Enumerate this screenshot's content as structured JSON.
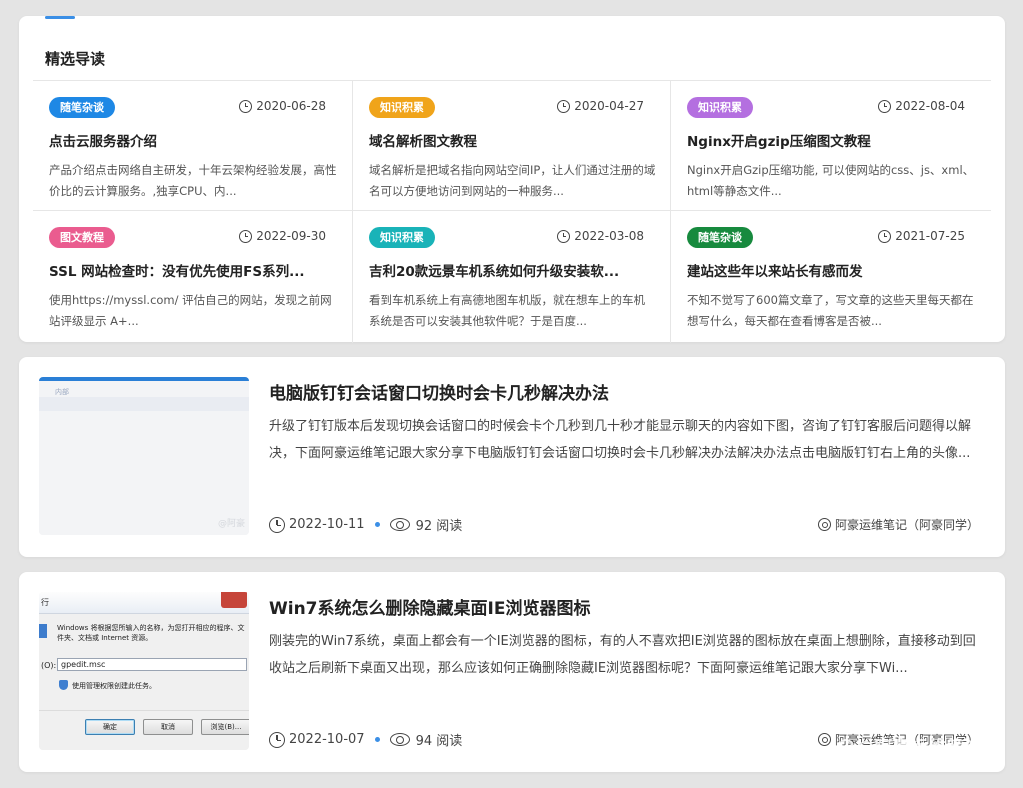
{
  "featured": {
    "title": "精选导读",
    "items": [
      {
        "tag": "随笔杂谈",
        "tag_color": "#1e88e5",
        "date": "2020-06-28",
        "title": "点击云服务器介绍",
        "excerpt": "产品介绍点击网络自主研发，十年云架构经验发展，高性价比的云计算服务。,独享CPU、内..."
      },
      {
        "tag": "知识积累",
        "tag_color": "#f0a41a",
        "date": "2020-04-27",
        "title": "域名解析图文教程",
        "excerpt": "域名解析是把域名指向网站空间IP，让人们通过注册的域名可以方便地访问到网站的一种服务..."
      },
      {
        "tag": "知识积累",
        "tag_color": "#b46fe0",
        "date": "2022-08-04",
        "title": "Nginx开启gzip压缩图文教程",
        "excerpt": "Nginx开启Gzip压缩功能, 可以使网站的css、js、xml、html等静态文件..."
      },
      {
        "tag": "图文教程",
        "tag_color": "#ea5c8f",
        "date": "2022-09-30",
        "title": "SSL 网站检查时：没有优先使用FS系列...",
        "excerpt": "使用https://myssl.com/ 评估自己的网站，发现之前网站评级显示 A+..."
      },
      {
        "tag": "知识积累",
        "tag_color": "#19b3b8",
        "date": "2022-03-08",
        "title": "吉利20款远景车机系统如何升级安装软...",
        "excerpt": "看到车机系统上有高德地图车机版，就在想车上的车机系统是否可以安装其他软件呢？于是百度..."
      },
      {
        "tag": "随笔杂谈",
        "tag_color": "#178a3e",
        "date": "2021-07-25",
        "title": "建站这些年以来站长有感而发",
        "excerpt": "不知不觉写了600篇文章了，写文章的这些天里每天都在想写什么，每天都在查看博客是否被..."
      }
    ]
  },
  "posts": [
    {
      "title": "电脑版钉钉会话窗口切换时会卡几秒解决办法",
      "excerpt": "升级了钉钉版本后发现切换会话窗口的时候会卡个几秒到几十秒才能显示聊天的内容如下图，咨询了钉钉客服后问题得以解决，下面阿豪运维笔记跟大家分享下电脑版钉钉会话窗口切换时会卡几秒解决办法解决办法点击电脑版钉钉右上角的头像...",
      "date": "2022-10-11",
      "views": "92 阅读",
      "author": "阿豪运维笔记（阿豪同学）",
      "thumb": {
        "label": "内部",
        "watermark": "@阿豪"
      }
    },
    {
      "title": "Win7系统怎么删除隐藏桌面IE浏览器图标",
      "excerpt": "刚装完的Win7系统，桌面上都会有一个IE浏览器的图标，有的人不喜欢把IE浏览器的图标放在桌面上想删除，直接移动到回收站之后刷新下桌面又出现，那么应该如何正确删除隐藏IE浏览器图标呢？下面阿豪运维笔记跟大家分享下Wi...",
      "date": "2022-10-07",
      "views": "94 阅读",
      "author": "阿豪运维笔记（阿豪同学）",
      "thumb": {
        "window_title": "行",
        "message": "Windows 将根据您所输入的名称，为您打开相应的程序、文件夹、文档或 Internet 资源。",
        "open_label": "(O):",
        "input_value": "gpedit.msc",
        "admin_note": "使用管理权限创建此任务。",
        "ok": "确定",
        "cancel": "取消",
        "browse": "浏览(B)..."
      }
    }
  ],
  "watermark": "@阿豪运维笔记"
}
